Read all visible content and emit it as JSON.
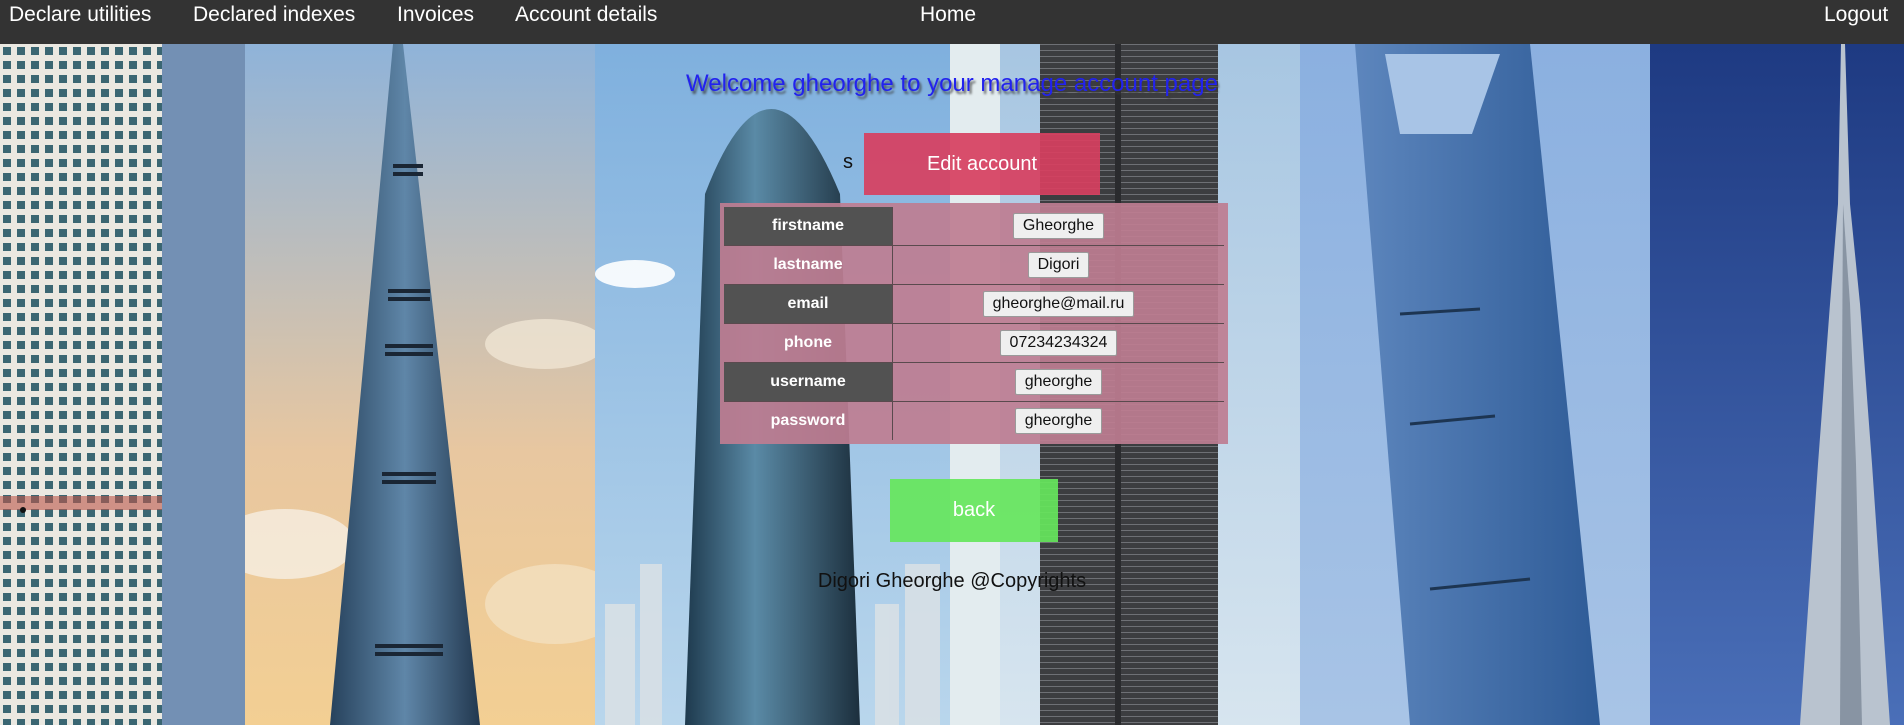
{
  "nav": {
    "declare_utilities": "Declare utilities",
    "declared_indexes": "Declared indexes",
    "invoices": "Invoices",
    "account_details": "Account details",
    "home": "Home",
    "logout": "Logout"
  },
  "page": {
    "welcome": "Welcome gheorghe to your manage account page",
    "stray_text": "s",
    "edit_button": "Edit account",
    "back_button": "back",
    "copyright": "Digori Gheorghe @Copyrights"
  },
  "account": {
    "rows": [
      {
        "label": "firstname",
        "value": "Gheorghe"
      },
      {
        "label": "lastname",
        "value": "Digori"
      },
      {
        "label": "email",
        "value": "gheorghe@mail.ru"
      },
      {
        "label": "phone",
        "value": "07234234324"
      },
      {
        "label": "username",
        "value": "gheorghe"
      },
      {
        "label": "password",
        "value": "gheorghe"
      }
    ]
  },
  "colors": {
    "nav_bg": "#333333",
    "welcome_text": "#2222ee",
    "edit_button_bg": "#d73f5f",
    "back_button_bg": "#66e65c",
    "table_bg": "#be7d91",
    "label_dark_bg": "#525252"
  }
}
